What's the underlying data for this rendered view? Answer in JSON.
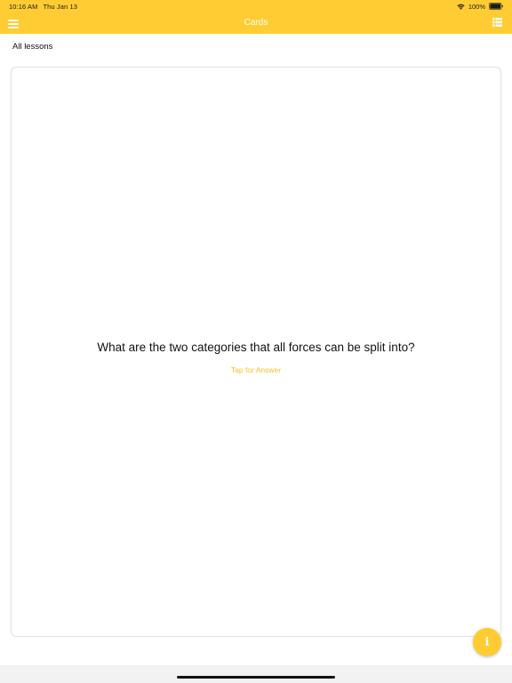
{
  "status_bar": {
    "time": "10:16 AM",
    "date": "Thu Jan 13",
    "battery": "100%"
  },
  "nav": {
    "title": "Cards",
    "menu_icon": "hamburger-icon",
    "list_icon": "list-icon"
  },
  "lessons_filter": "All lessons",
  "card": {
    "question": "What are the two categories that all forces can be split into?",
    "hint": "Tap for Answer"
  },
  "info_button": "i",
  "colors": {
    "accent": "#ffcc33",
    "hint": "#f2c12e"
  }
}
